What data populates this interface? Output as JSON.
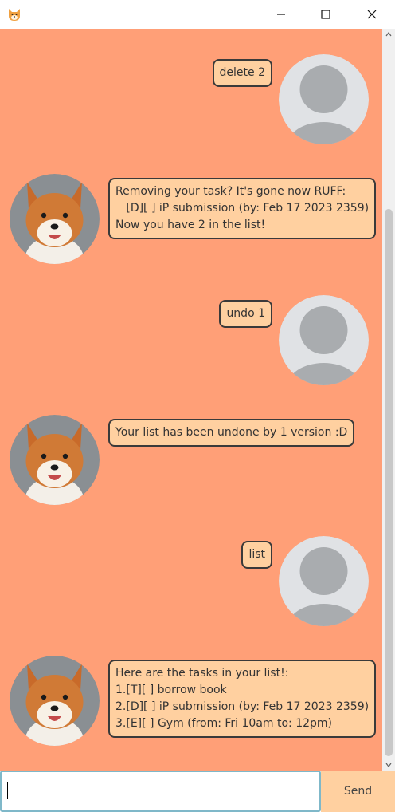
{
  "window": {
    "icon": "shiba-icon",
    "controls": [
      "minimize-icon",
      "maximize-icon",
      "close-icon"
    ]
  },
  "colors": {
    "chat_background": "#ff9f77",
    "bubble_background": "#ffd0a0",
    "bubble_border": "#3a3a3a",
    "user_avatar_bg": "#e0e2e5",
    "user_avatar_fg": "#a9acaf"
  },
  "messages": [
    {
      "sender": "user",
      "avatar": "default-user-avatar",
      "text": "delete 2"
    },
    {
      "sender": "bot",
      "avatar": "shiba-dog-avatar",
      "text": "Removing your task? It's gone now RUFF:\n   [D][ ] iP submission (by: Feb 17 2023 2359)\nNow you have 2 in the list!"
    },
    {
      "sender": "user",
      "avatar": "default-user-avatar",
      "text": "undo 1"
    },
    {
      "sender": "bot",
      "avatar": "shiba-dog-avatar",
      "text": "Your list has been undone by 1 version :D"
    },
    {
      "sender": "user",
      "avatar": "default-user-avatar",
      "text": "list"
    },
    {
      "sender": "bot",
      "avatar": "shiba-dog-avatar",
      "text": "Here are the tasks in your list!:\n1.[T][ ] borrow book\n2.[D][ ] iP submission (by: Feb 17 2023 2359)\n3.[E][ ] Gym (from: Fri 10am to: 12pm)"
    }
  ],
  "input": {
    "value": "",
    "placeholder": ""
  },
  "send_button": {
    "label": "Send"
  }
}
